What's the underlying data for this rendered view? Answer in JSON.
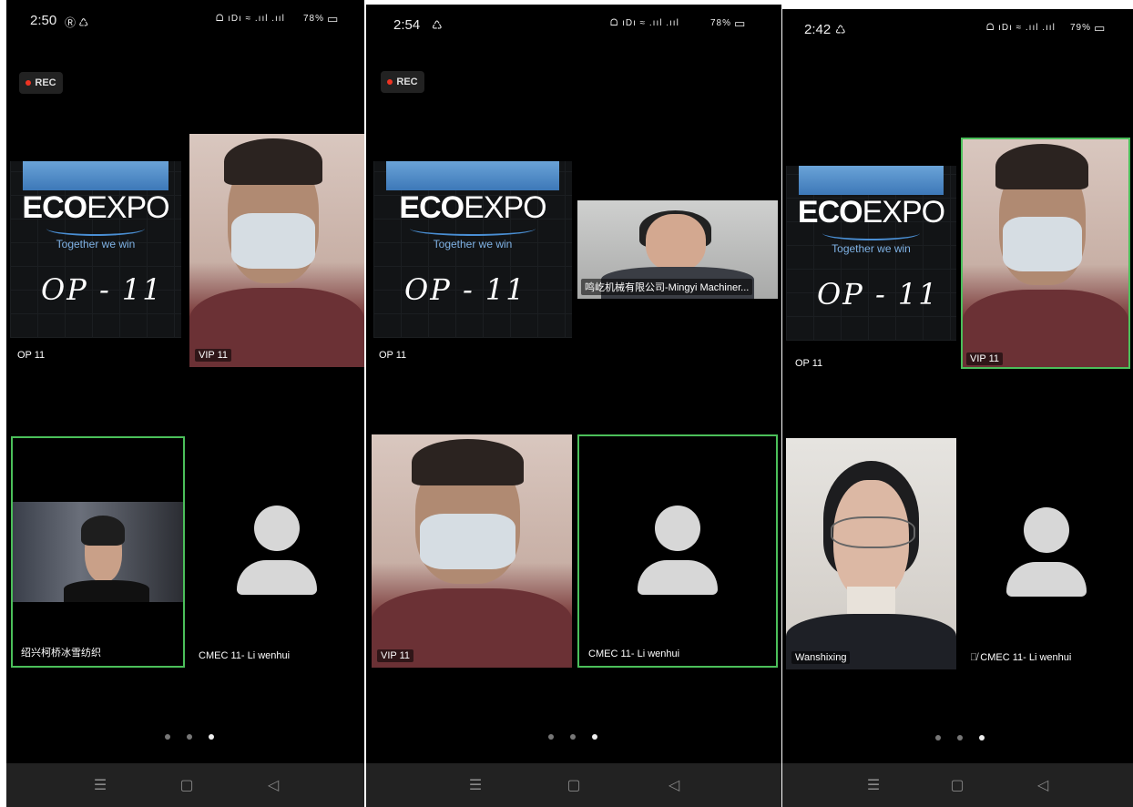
{
  "screens": [
    {
      "time": "2:50",
      "status_icons": "ᗝ ıDı ≈ .ııl .ııl",
      "battery": "78%",
      "rec_label": "REC",
      "eco": {
        "logo_bold": "ECO",
        "logo_rest": "EXPO",
        "tagline": "Together we win",
        "op_text": "OP - 11"
      },
      "tiles": {
        "op": "OP 11",
        "vip": "VIP 11",
        "bottom_left": "绍兴柯桥冰雪纺织",
        "bottom_right": "CMEC 11- Li wenhui"
      },
      "page_dots": 3,
      "active_dot": 2
    },
    {
      "time": "2:54",
      "status_icons": "ᗝ ıDı ≈ .ııl .ııl",
      "battery": "78%",
      "rec_label": "REC",
      "eco": {
        "logo_bold": "ECO",
        "logo_rest": "EXPO",
        "tagline": "Together we win",
        "op_text": "OP - 11"
      },
      "tiles": {
        "op": "OP 11",
        "top_right": "鸣屹机械有限公司-Mingyi Machiner...",
        "vip": "VIP 11",
        "bottom_right": "CMEC 11- Li wenhui"
      },
      "page_dots": 3,
      "active_dot": 2
    },
    {
      "time": "2:42",
      "status_icons": "ᗝ ıDı ≈ .ııl .ııl",
      "battery": "79%",
      "eco": {
        "logo_bold": "ECO",
        "logo_rest": "EXPO",
        "tagline": "Together we win",
        "op_text": "OP - 11"
      },
      "tiles": {
        "op": "OP 11",
        "vip": "VIP 11",
        "bottom_left": "Wanshixing",
        "bottom_right": "CMEC 11- Li wenhui"
      },
      "page_dots": 3,
      "active_dot": 2
    }
  ],
  "navbar": {
    "menu": "☰",
    "home": "▢",
    "back": "◁"
  },
  "icons": {
    "phone1_status": "alarm-icon",
    "network": "wifi-icon",
    "mic_muted": "mic-off-icon"
  },
  "colors": {
    "active_border": "#4bbf5a",
    "rec_dot": "#ee3322",
    "background": "#000000"
  }
}
